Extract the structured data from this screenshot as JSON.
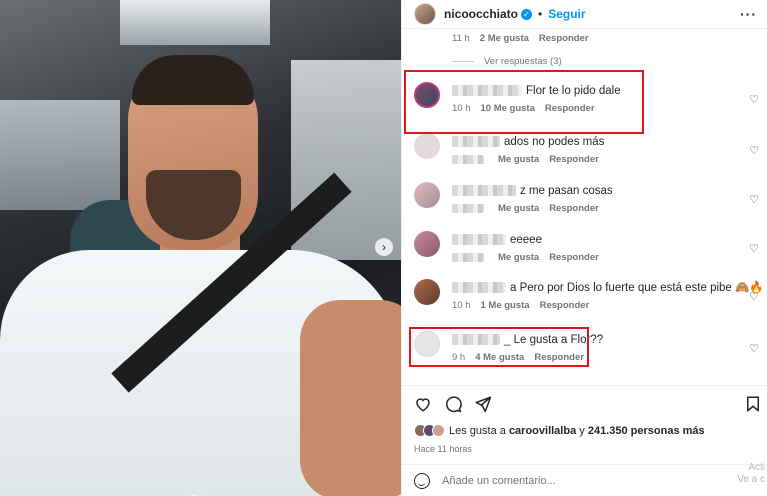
{
  "header": {
    "username": "nicoocchiato",
    "separator": "•",
    "follow_label": "Seguir",
    "more_label": "···"
  },
  "top_comment_meta": {
    "time": "11 h",
    "likes": "2 Me gusta",
    "reply": "Responder"
  },
  "view_replies": "Ver respuestas (3)",
  "comments": [
    {
      "text": "Flor te lo pido dale",
      "time": "10 h",
      "likes": "10 Me gusta",
      "reply": "Responder",
      "avatar_color": "#7a4c5e"
    },
    {
      "text": "ados no podes más",
      "time": "",
      "likes": "Me gusta",
      "reply": "Responder",
      "avatar_color": "#e2dada"
    },
    {
      "text": "z me pasan cosas",
      "time": "",
      "likes": "Me gusta",
      "reply": "Responder",
      "avatar_color": "#e8b8c6"
    },
    {
      "text": "eeeee",
      "time": "",
      "likes": "Me gusta",
      "reply": "Responder",
      "avatar_color": "#c98a9c"
    },
    {
      "text": "a Pero por Dios lo fuerte que está este pibe 🙈🔥",
      "time": "10 h",
      "likes": "1 Me gusta",
      "reply": "Responder",
      "avatar_color": "#b56a4e"
    },
    {
      "text": "_ Le gusta a Flor??",
      "time": "9 h",
      "likes": "4 Me gusta",
      "reply": "Responder",
      "avatar_color": "#e6e6e6"
    }
  ],
  "likes": {
    "prefix": "Les gusta a ",
    "user": "caroovillalba",
    "middle": " y ",
    "count": "241.350 personas más"
  },
  "posted_ago": "Hace 11 horas",
  "add_comment_placeholder": "Añade un comentario...",
  "watermark": {
    "line1": "Acti",
    "line2": "Ve a c"
  },
  "colors": {
    "accent": "#0095f6",
    "highlight": "#e0161c"
  }
}
